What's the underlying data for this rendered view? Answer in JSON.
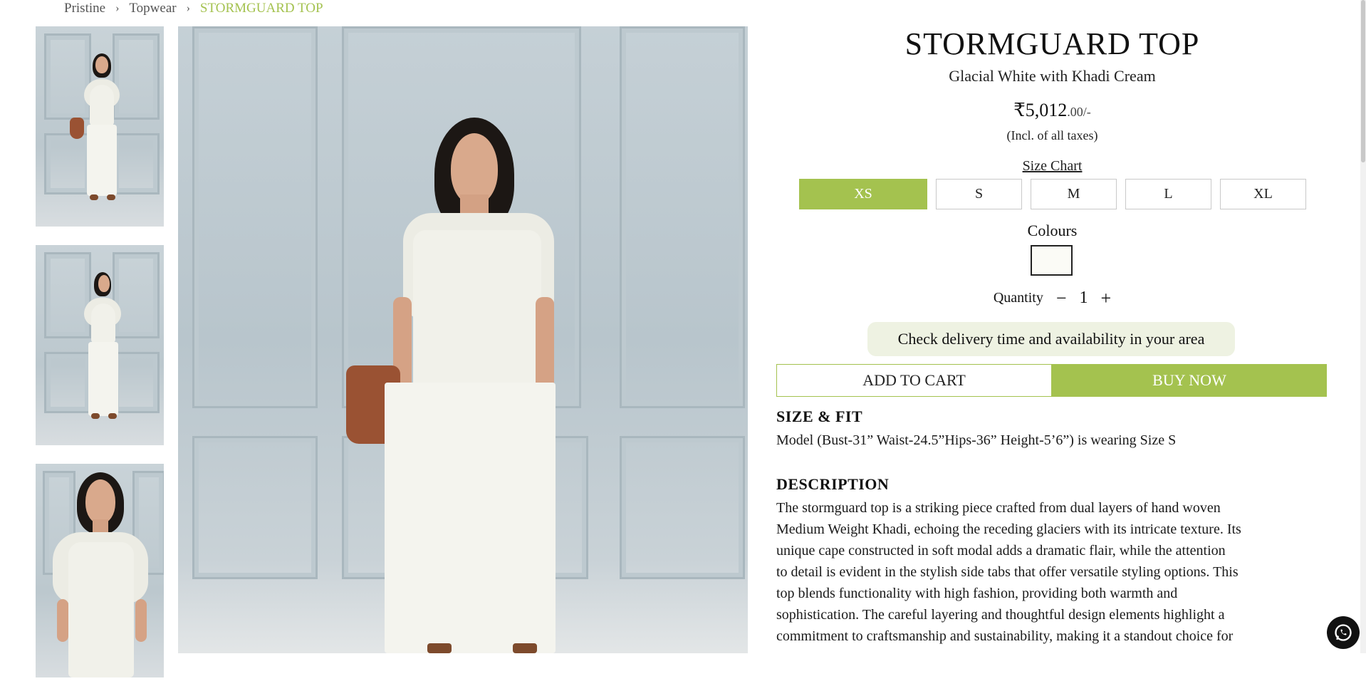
{
  "breadcrumb": {
    "items": [
      "Pristine",
      "Topwear"
    ],
    "current": "STORMGUARD TOP",
    "separator": "›"
  },
  "gallery": {
    "thumbnails": [
      {
        "alt": "Model front view"
      },
      {
        "alt": "Model three-quarter view"
      },
      {
        "alt": "Model close-up view"
      }
    ],
    "main_alt": "Model wearing Stormguard Top"
  },
  "product": {
    "title": "STORMGUARD TOP",
    "subtitle": "Glacial White with Khadi Cream",
    "price_main": "₹5,012",
    "price_decimal": ".00/-",
    "tax_note": "(Incl. of all taxes)",
    "size_chart_label": "Size Chart",
    "sizes": [
      "XS",
      "S",
      "M",
      "L",
      "XL"
    ],
    "selected_size": "XS",
    "colours_label": "Colours",
    "quantity_label": "Quantity",
    "quantity_value": "1",
    "decrement_label": "−",
    "increment_label": "+",
    "delivery_label": "Check delivery time and availability in your area",
    "add_to_cart_label": "ADD TO CART",
    "buy_now_label": "BUY NOW"
  },
  "size_fit": {
    "heading": "SIZE & FIT",
    "text": "Model (Bust-31” Waist-24.5”Hips-36” Height-5’6”) is wearing Size S"
  },
  "description": {
    "heading": "DESCRIPTION",
    "lines": [
      "The stormguard top is a striking piece crafted from dual layers of hand woven",
      "Medium Weight Khadi, echoing the receding glaciers with its intricate texture. Its",
      "unique cape constructed in soft modal adds a dramatic flair, while the attention",
      "to detail is evident in the stylish side tabs that offer versatile styling options. This",
      "top blends functionality with high fashion, providing both warmth and",
      "sophistication. The careful layering and thoughtful design elements highlight a",
      "commitment to craftsmanship and sustainability, making it a standout choice for"
    ]
  },
  "colors": {
    "accent": "#a4c24f",
    "delivery_bg": "#eef2e2",
    "swatch": "#fbfbf6"
  },
  "icons": {
    "whatsapp": "whatsapp-icon"
  }
}
